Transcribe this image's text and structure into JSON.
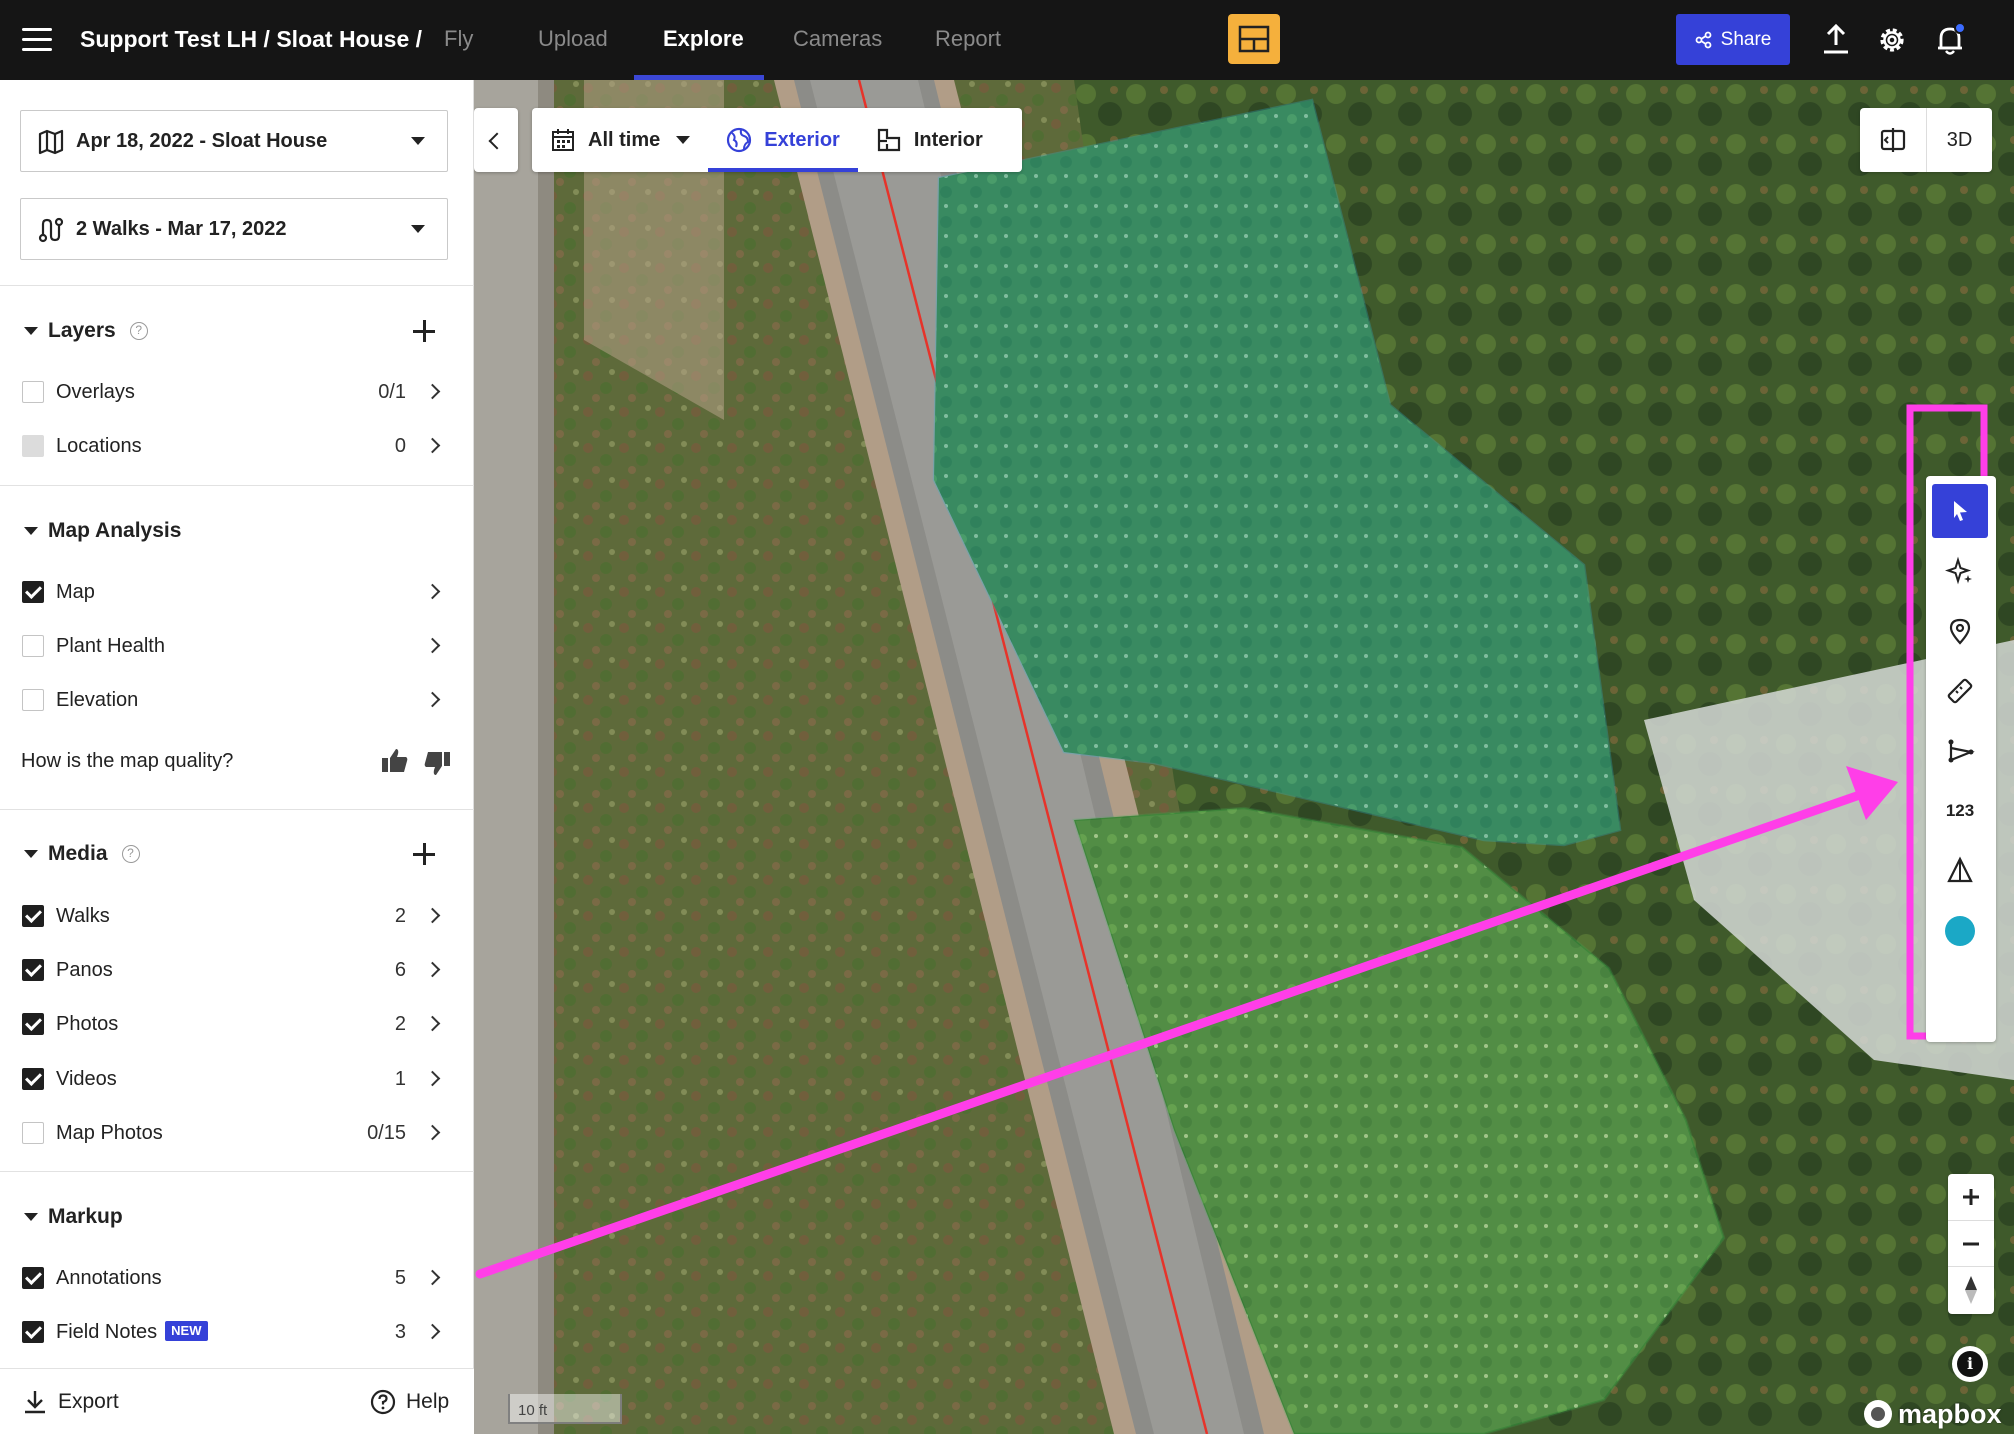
{
  "topbar": {
    "breadcrumb": "Support Test LH / Sloat House /",
    "tabs": [
      {
        "label": "Fly",
        "active": false
      },
      {
        "label": "Upload",
        "active": false
      },
      {
        "label": "Explore",
        "active": true
      },
      {
        "label": "Cameras",
        "active": false
      },
      {
        "label": "Report",
        "active": false
      }
    ],
    "share_label": "Share",
    "icons": [
      "menu-icon",
      "layout-icon",
      "share-icon",
      "upload-icon",
      "gear-icon",
      "bell-icon"
    ]
  },
  "sidebar": {
    "map_selector": "Apr 18, 2022 - Sloat House",
    "walks_selector": "2 Walks - Mar 17, 2022",
    "layers": {
      "title": "Layers",
      "help": "?",
      "items": [
        {
          "label": "Overlays",
          "count": "0/1",
          "checked": false
        },
        {
          "label": "Locations",
          "count": "0",
          "checked": false
        }
      ]
    },
    "map_analysis": {
      "title": "Map Analysis",
      "items": [
        {
          "label": "Map",
          "checked": true
        },
        {
          "label": "Plant Health",
          "checked": false
        },
        {
          "label": "Elevation",
          "checked": false
        }
      ],
      "quality_question": "How is the map quality?"
    },
    "media": {
      "title": "Media",
      "help": "?",
      "items": [
        {
          "label": "Walks",
          "count": "2",
          "checked": true
        },
        {
          "label": "Panos",
          "count": "6",
          "checked": true
        },
        {
          "label": "Photos",
          "count": "2",
          "checked": true
        },
        {
          "label": "Videos",
          "count": "1",
          "checked": true
        },
        {
          "label": "Map Photos",
          "count": "0/15",
          "checked": false
        }
      ]
    },
    "markup": {
      "title": "Markup",
      "items": [
        {
          "label": "Annotations",
          "count": "5",
          "checked": true
        },
        {
          "label": "Field Notes",
          "count": "3",
          "checked": true,
          "badge": "NEW"
        }
      ]
    },
    "footer": {
      "export_label": "Export",
      "help_label": "Help"
    }
  },
  "map": {
    "time_filter": "All time",
    "view_tabs": [
      {
        "label": "Exterior",
        "active": true
      },
      {
        "label": "Interior",
        "active": false
      }
    ],
    "mode_3d": "3D",
    "tools": [
      "select-tool",
      "magic-draw-tool",
      "location-pin-tool",
      "ruler-tool",
      "polyline-tool",
      "count-tool",
      "elevation-tool",
      "color-tool"
    ],
    "count_tool_label": "123",
    "scale_label": "10 ft",
    "attribution": "mapbox",
    "info_label": "i",
    "annotation_color": "#ff3ee8",
    "color_swatch": "#1ba8c6"
  },
  "colors": {
    "accent": "#3541d8",
    "topbar_bg": "#151515",
    "layout_button": "#f5b03c",
    "polygon_blue": "#2bb6d6",
    "polygon_green": "#3fb85a",
    "path_red": "#e6332a"
  }
}
